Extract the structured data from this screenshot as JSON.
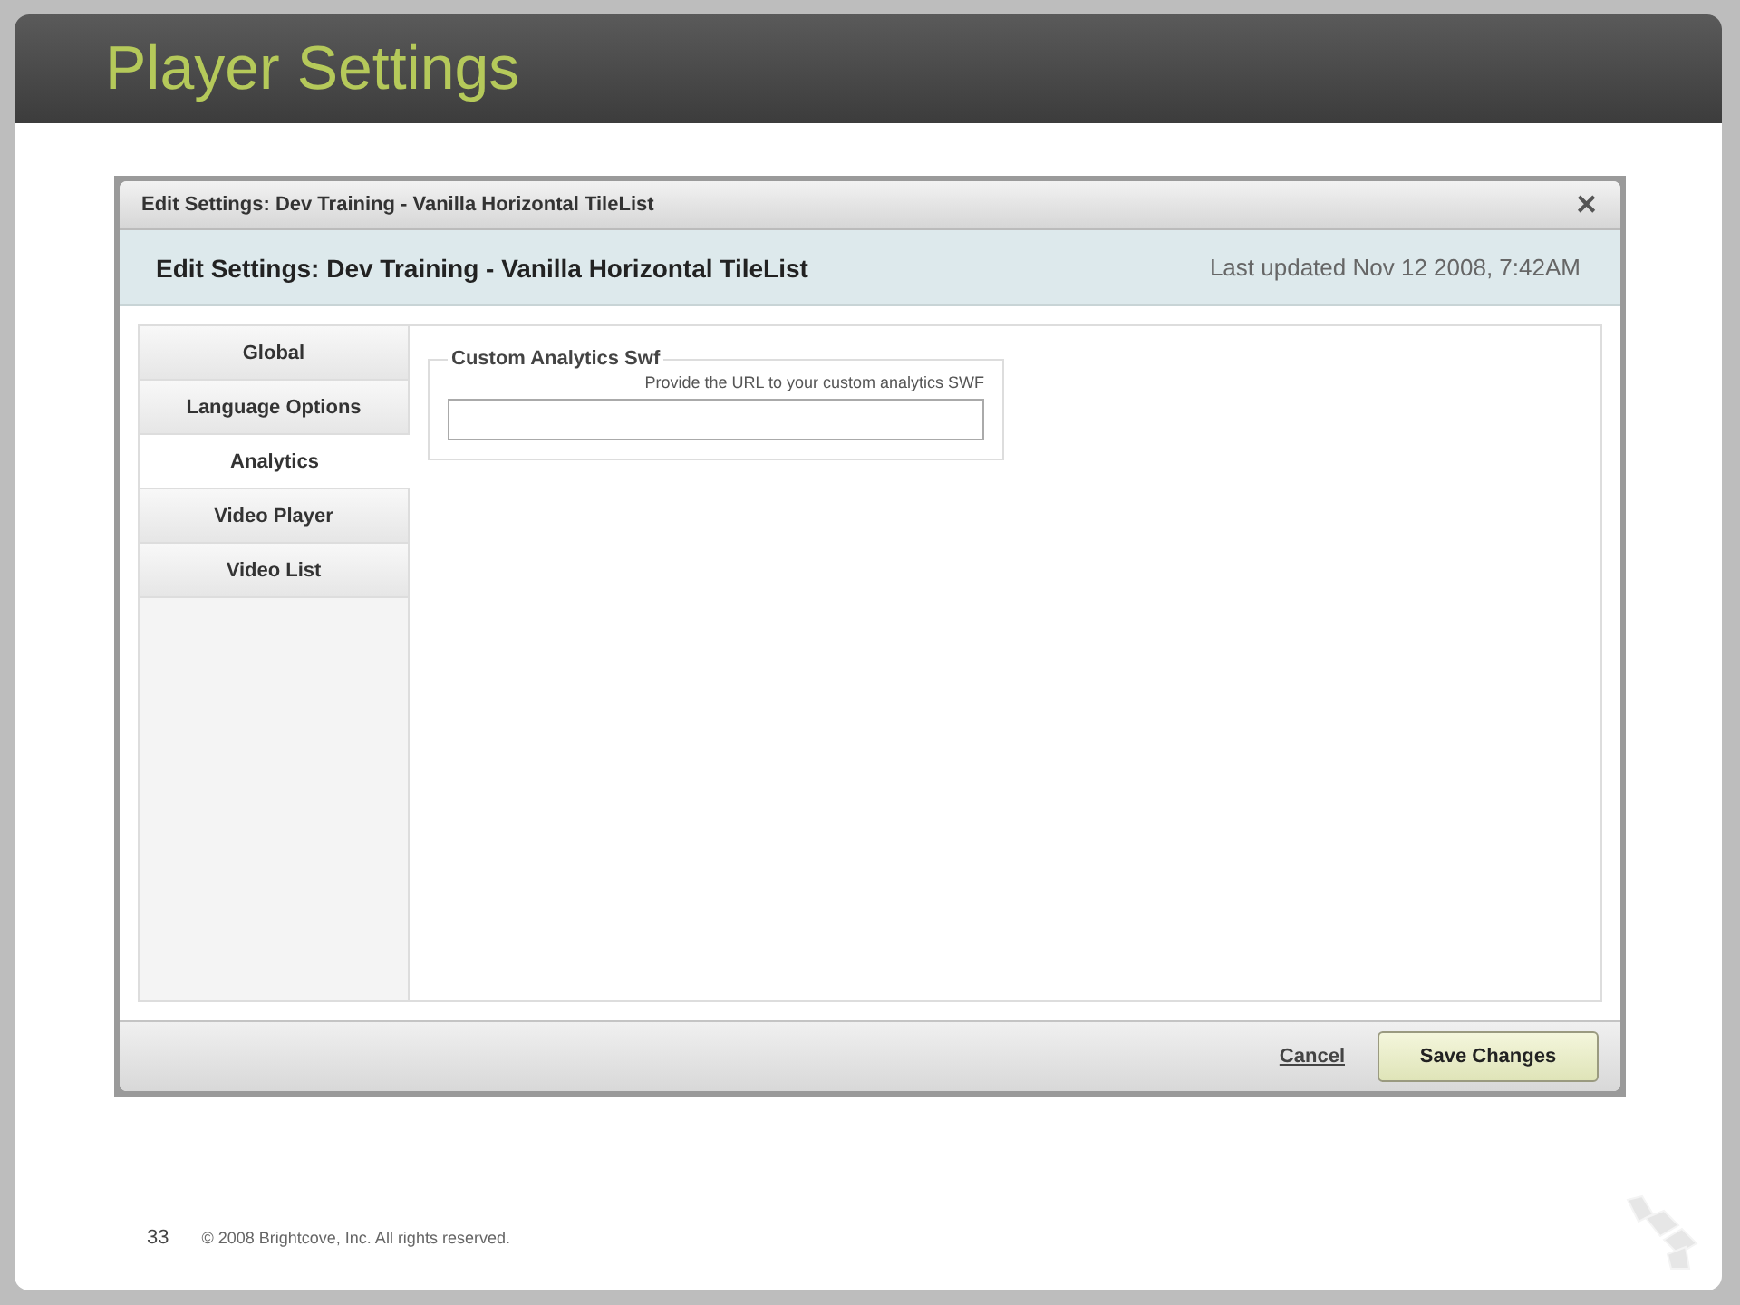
{
  "slide": {
    "title": "Player Settings",
    "page_number": "33",
    "footer": "© 2008 Brightcove, Inc. All rights reserved."
  },
  "dialog": {
    "title": "Edit Settings: Dev Training - Vanilla Horizontal TileList",
    "close": "✕",
    "heading": "Edit Settings: Dev Training - Vanilla Horizontal TileList",
    "last_updated": "Last updated Nov 12 2008, 7:42AM",
    "tabs": [
      {
        "label": "Global",
        "selected": false
      },
      {
        "label": "Language Options",
        "selected": false
      },
      {
        "label": "Analytics",
        "selected": true
      },
      {
        "label": "Video Player",
        "selected": false
      },
      {
        "label": "Video List",
        "selected": false
      }
    ],
    "fieldset": {
      "legend": "Custom Analytics Swf",
      "hint": "Provide the URL to your custom analytics SWF"
    },
    "buttons": {
      "cancel": "Cancel",
      "save": "Save Changes"
    }
  }
}
